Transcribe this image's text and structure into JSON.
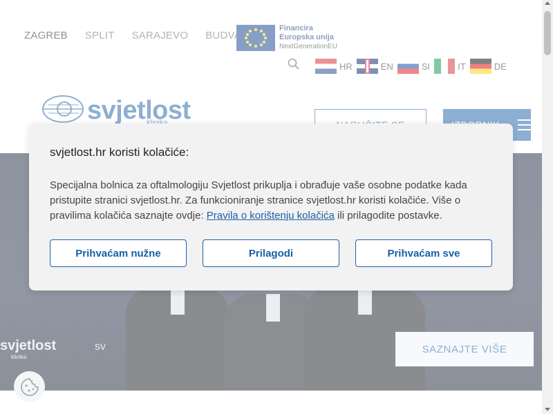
{
  "header": {
    "cities": [
      "ZAGREB",
      "SPLIT",
      "SARAJEVO",
      "BUDVA"
    ],
    "active_city": "ZAGREB",
    "eu": {
      "line1": "Financira",
      "line2": "Europska unija",
      "line3": "NextGenerationEU"
    },
    "search_icon": "search-icon",
    "languages": [
      {
        "code": "HR",
        "flag": "flag-croatia"
      },
      {
        "code": "EN",
        "flag": "flag-uk"
      },
      {
        "code": "SI",
        "flag": "flag-slovenia"
      },
      {
        "code": "IT",
        "flag": "flag-italy"
      },
      {
        "code": "DE",
        "flag": "flag-germany"
      }
    ]
  },
  "logo": {
    "word": "svjetlost",
    "sub": "klinika"
  },
  "nav": {
    "narucite_label": "NARUČITE SE",
    "izbornik_label": "IZBORNIK"
  },
  "hero": {
    "logo_left": "svjetlost",
    "logo_left_sub": "klinika",
    "logo_mid": "sv",
    "saznajte_label": "SAZNAJTE VIŠE"
  },
  "cookie_modal": {
    "title": "svjetlost.hr koristi kolačiće:",
    "text_before_link": "Specijalna bolnica za oftalmologiju Svjetlost prikuplja i obrađuje vaše osobne podatke kada pristupite stranici svjetlost.hr. Za funkcioniranje stranice svjetlost.hr koristi kolačiće. Više o pravilima kolačića saznajte ovdje: ",
    "link_text": "Pravila o korištenju kolačića",
    "text_after_link": " ili prilagodite postavke.",
    "buttons": {
      "necessary": "Prihvaćam nužne",
      "customize": "Prilagodi",
      "accept_all": "Prihvaćam sve"
    }
  },
  "colors": {
    "brand_blue": "#1a5fa6",
    "hero_dark": "#1c2740",
    "modal_bg": "#f2f2f2"
  }
}
